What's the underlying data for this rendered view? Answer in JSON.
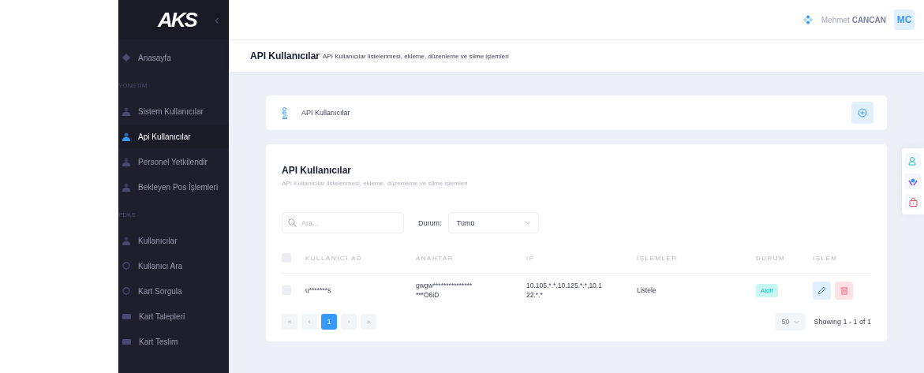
{
  "sidebar": {
    "logo": "AKS",
    "collapse": "‹",
    "items": [
      {
        "kind": "home",
        "label": "Anasayfa",
        "selected": false
      },
      {
        "kind": "section",
        "label": "YÖNETİM"
      },
      {
        "kind": "user",
        "label": "Sistem Kullanıcılar",
        "selected": false
      },
      {
        "kind": "user",
        "label": "Api Kullanıcılar",
        "selected": true
      },
      {
        "kind": "user",
        "label": "Personel Yetkilendir",
        "selected": false
      },
      {
        "kind": "user",
        "label": "Bekleyen Pos İşlemleri",
        "selected": false
      },
      {
        "kind": "section",
        "label": "PDKS"
      },
      {
        "kind": "user",
        "label": "Kullanıcılar",
        "selected": false
      },
      {
        "kind": "search",
        "label": "Kullanıcı Ara",
        "selected": false
      },
      {
        "kind": "search",
        "label": "Kart Sorgula",
        "selected": false
      },
      {
        "kind": "card",
        "label": "Kart Talepleri",
        "selected": false
      },
      {
        "kind": "card",
        "label": "Kart Teslim",
        "selected": false
      }
    ]
  },
  "header": {
    "user_first": "Mehmet",
    "user_last": "CANCAN",
    "avatar": "MC"
  },
  "subheader": {
    "title": "API Kullanıcılar",
    "description": "API Kullanıcılar listelenmesi, ekleme, düzenleme ve silme işlemleri"
  },
  "info_card": {
    "title": "API Kullanıcılar"
  },
  "list_card": {
    "title": "API Kullanıcılar",
    "description": "API Kullanıcılar listelenmesi, ekleme, düzenleme ve silme işlemleri",
    "search": {
      "placeholder": "Ara..."
    },
    "filter": {
      "label": "Durum:",
      "value": "Tümü"
    },
    "table": {
      "columns": [
        "KULLANICI AD",
        "ANAHTAR",
        "IP",
        "İŞLEMLER",
        "DURUM",
        "İŞLEM"
      ],
      "all_checked": false,
      "rows": [
        {
          "checked": false,
          "user": "u*******s",
          "key": "gwgw***************\n***O6iD",
          "ip": "10.105.*.*,10.125.*.*,10.1\n22.*.*",
          "operations": "Listele",
          "status": "Aktif"
        }
      ]
    },
    "pagination": [
      {
        "label": "«",
        "selected": false
      },
      {
        "label": "‹",
        "selected": false
      },
      {
        "label": "1",
        "selected": true
      },
      {
        "label": "›",
        "selected": false
      },
      {
        "label": "»",
        "selected": false
      }
    ],
    "page_size": "50",
    "showing": "Showing 1 - 1 of 1"
  }
}
